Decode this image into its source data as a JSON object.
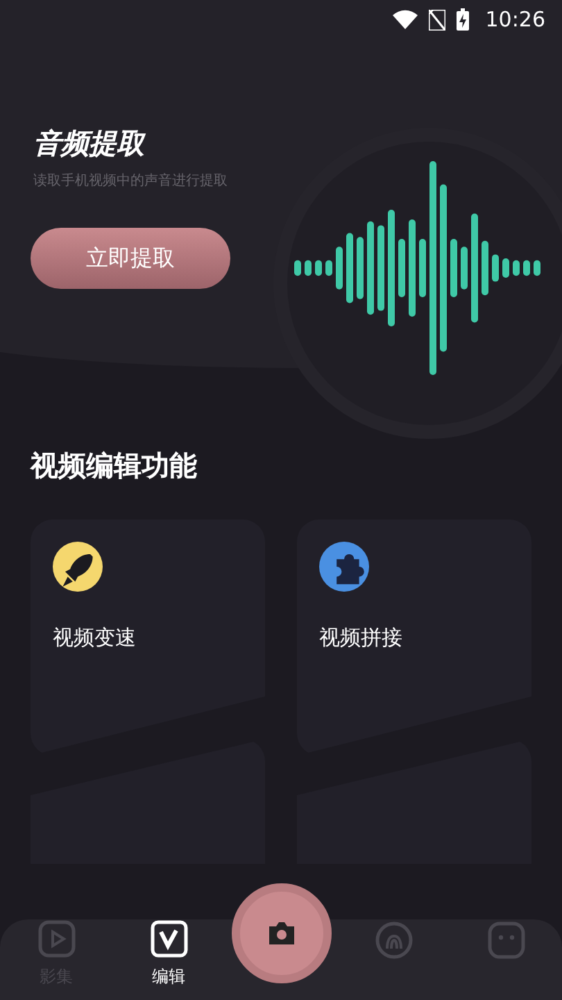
{
  "status_bar": {
    "time": "10:26"
  },
  "hero": {
    "title": "音频提取",
    "subtitle": "读取手机视频中的声音进行提取",
    "button": "立即提取"
  },
  "section": {
    "title": "视频编辑功能"
  },
  "features": [
    {
      "label": "视频变速",
      "kind": "rocket",
      "color": "#f5d76e"
    },
    {
      "label": "视频拼接",
      "kind": "puzzle",
      "color": "#4a90e2"
    }
  ],
  "nav": [
    {
      "label": "影集",
      "kind": "play",
      "selected": false
    },
    {
      "label": "编辑",
      "kind": "edit",
      "selected": true
    },
    {
      "kind": "camera",
      "selected": false
    },
    {
      "kind": "fingerprint",
      "selected": false
    },
    {
      "kind": "face",
      "selected": false
    }
  ]
}
